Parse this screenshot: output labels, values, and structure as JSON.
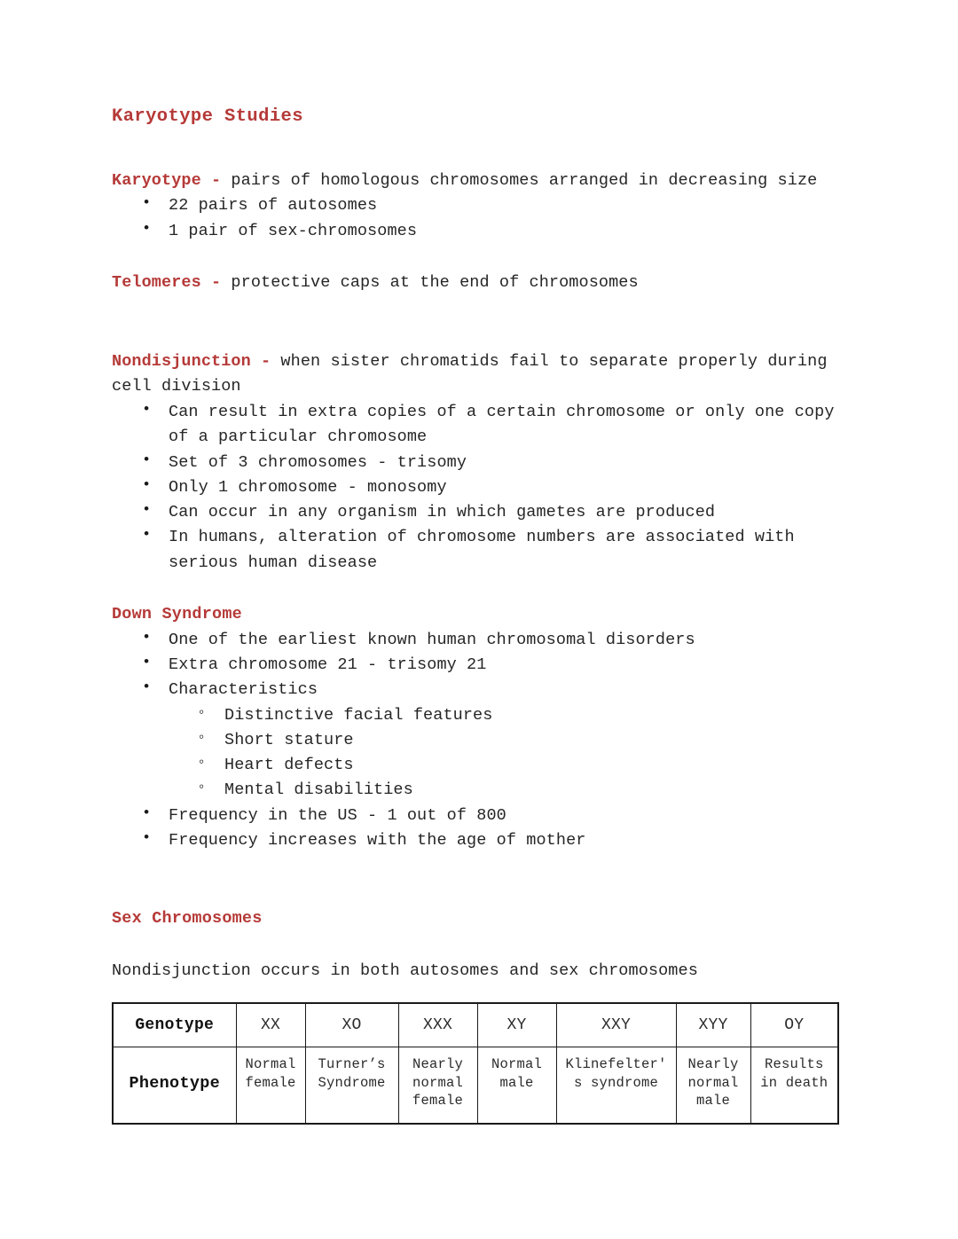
{
  "document": {
    "title": "Karyotype Studies"
  },
  "definitions": {
    "karyotype": {
      "term": "Karyotype",
      "dash": "-",
      "text": " pairs of homologous chromosomes arranged in decreasing size"
    },
    "telomeres": {
      "term": "Telomeres",
      "dash": "-",
      "text": " protective caps at the end of chromosomes"
    },
    "nondisjunction": {
      "term": "Nondisjunction",
      "dash": "-",
      "text": " when sister chromatids fail to separate properly during cell division"
    }
  },
  "karyotype_bullets": [
    "22 pairs of autosomes",
    "1 pair of sex-chromosomes"
  ],
  "nondisjunction_bullets": [
    "Can result in extra copies of a certain chromosome or only one copy of a particular chromosome",
    "Set of 3  chromosomes - trisomy",
    "Only 1 chromosome - monosomy",
    "Can occur in any organism in which gametes are produced",
    "In humans, alteration of chromosome numbers are associated with serious human disease"
  ],
  "down_syndrome": {
    "heading": "Down Syndrome",
    "bullets_before": [
      "One of the earliest known human chromosomal disorders",
      "Extra chromosome 21 - trisomy 21",
      "Characteristics"
    ],
    "characteristics": [
      "Distinctive facial features",
      "Short stature",
      "Heart defects",
      "Mental disabilities"
    ],
    "bullets_after": [
      "Frequency in the US - 1 out of 800",
      "Frequency increases with the age of mother"
    ]
  },
  "sex_chromosomes": {
    "heading": "Sex Chromosomes",
    "intro": "Nondisjunction occurs in both autosomes and sex chromosomes",
    "table": {
      "row_labels": [
        "Genotype",
        "Phenotype"
      ],
      "genotypes": [
        "XX",
        "XO",
        "XXX",
        "XY",
        "XXY",
        "XYY",
        "OY"
      ],
      "phenotypes": [
        "Normal\nfemale",
        "Turner’s\nSyndrome",
        "Nearly\nnormal\nfemale",
        "Normal\nmale",
        "Klinefelter'\ns syndrome",
        "Nearly\nnormal\nmale",
        "Results\nin death"
      ]
    }
  },
  "colors": {
    "heading_red": "#b53a38",
    "body_text": "#262626",
    "table_border": "#1a1a1a",
    "page_background": "#ffffff"
  }
}
